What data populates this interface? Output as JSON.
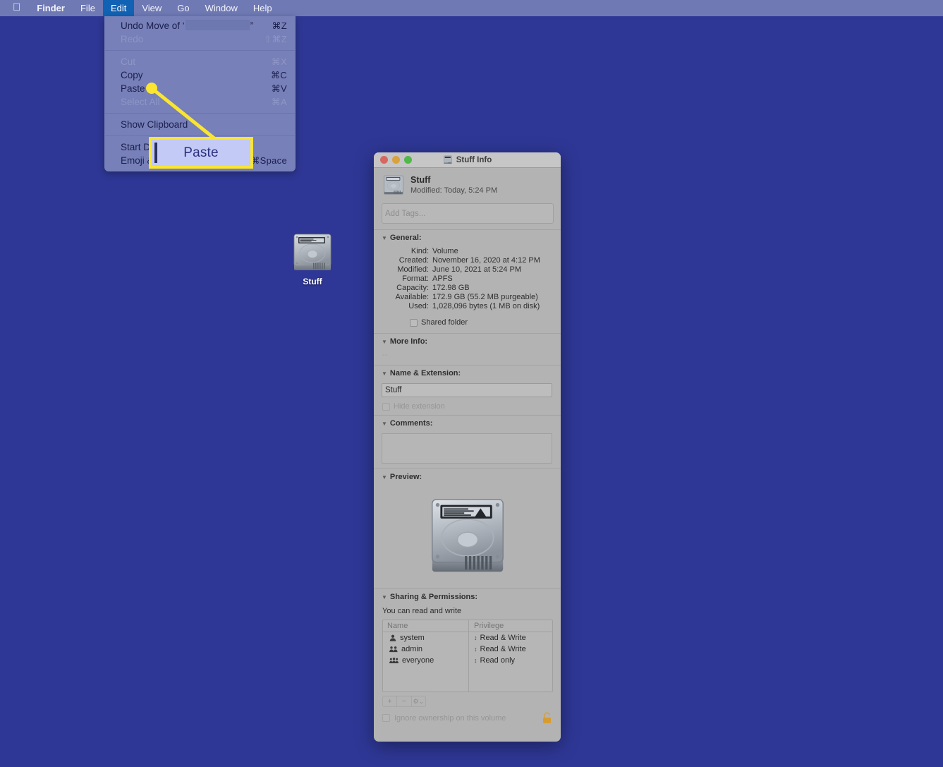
{
  "menubar": {
    "apple_icon": "apple-logo-icon",
    "items": [
      {
        "label": "Finder",
        "bold": true,
        "active": false
      },
      {
        "label": "File",
        "bold": false,
        "active": false
      },
      {
        "label": "Edit",
        "bold": false,
        "active": true
      },
      {
        "label": "View",
        "bold": false,
        "active": false
      },
      {
        "label": "Go",
        "bold": false,
        "active": false
      },
      {
        "label": "Window",
        "bold": false,
        "active": false
      },
      {
        "label": "Help",
        "bold": false,
        "active": false
      }
    ]
  },
  "edit_menu": {
    "rows": [
      {
        "label": "Undo Move of ‘",
        "label_after": "”",
        "key": "⌘Z",
        "disabled": false,
        "redacted": true
      },
      {
        "label": "Redo",
        "key": "⇧⌘Z",
        "disabled": true
      },
      {
        "separator": true
      },
      {
        "label": "Cut",
        "key": "⌘X",
        "disabled": true
      },
      {
        "label": "Copy",
        "key": "⌘C",
        "disabled": false
      },
      {
        "label": "Paste",
        "key": "⌘V",
        "disabled": false
      },
      {
        "label": "Select All",
        "key": "⌘A",
        "disabled": true
      },
      {
        "separator": true
      },
      {
        "label": "Show Clipboard",
        "key": "",
        "disabled": false
      },
      {
        "separator": true
      },
      {
        "label": "Start Dictation",
        "key": "",
        "disabled": false
      },
      {
        "label": "Emoji & Symbols",
        "key": "⌘Space",
        "disabled": false
      }
    ]
  },
  "annotation": {
    "callout_label": "Paste",
    "border_color": "#f9e532",
    "fill_color": "#c3caf5",
    "text_color": "#2b3080"
  },
  "desktop": {
    "background_color": "#2e3795",
    "drive_icon": {
      "name": "hard-drive-icon",
      "label": "Stuff"
    }
  },
  "info_window": {
    "title": "Stuff Info",
    "title_icon": "hard-drive-icon",
    "traffic_lights": {
      "close": "close-button",
      "minimize": "minimize-button",
      "maximize": "maximize-button",
      "close_color": "#d6685f",
      "minimize_color": "#d9a23c",
      "maximize_color": "#51b84a"
    },
    "header": {
      "name": "Stuff",
      "modified": "Modified: Today, 5:24 PM"
    },
    "tags": {
      "placeholder": "Add Tags..."
    },
    "general": {
      "section_label": "General:",
      "fields": [
        {
          "key": "Kind:",
          "value": "Volume"
        },
        {
          "key": "Created:",
          "value": "November 16, 2020 at 4:12 PM"
        },
        {
          "key": "Modified:",
          "value": "June 10, 2021 at 5:24 PM"
        },
        {
          "key": "Format:",
          "value": "APFS"
        },
        {
          "key": "Capacity:",
          "value": "172.98 GB"
        },
        {
          "key": "Available:",
          "value": "172.9 GB (55.2 MB purgeable)"
        },
        {
          "key": "Used:",
          "value": "1,028,096 bytes (1 MB on disk)"
        }
      ],
      "shared_folder_label": "Shared folder",
      "shared_folder_checked": false
    },
    "more_info": {
      "section_label": "More Info:",
      "value": "--"
    },
    "name_extension": {
      "section_label": "Name & Extension:",
      "value": "Stuff",
      "hide_extension_label": "Hide extension",
      "hide_extension_checked": false
    },
    "comments": {
      "section_label": "Comments:",
      "value": ""
    },
    "preview": {
      "section_label": "Preview:",
      "image": "hard-drive-icon"
    },
    "sharing": {
      "section_label": "Sharing & Permissions:",
      "note": "You can read and write",
      "columns": [
        "Name",
        "Privilege"
      ],
      "rows": [
        {
          "icon": "single-user-icon",
          "name": "system",
          "privilege": "Read & Write"
        },
        {
          "icon": "group-users-icon",
          "name": "admin",
          "privilege": "Read & Write"
        },
        {
          "icon": "group-users-icon",
          "name": "everyone",
          "privilege": "Read only"
        }
      ],
      "tools": {
        "add": "+",
        "remove": "−",
        "action": "⚙",
        "action_chevron": "⌄"
      },
      "ignore_ownership_label": "Ignore ownership on this volume",
      "ignore_ownership_checked": false,
      "lock_icon": "unlocked-padlock-icon",
      "lock_color": "#d79c31"
    }
  }
}
